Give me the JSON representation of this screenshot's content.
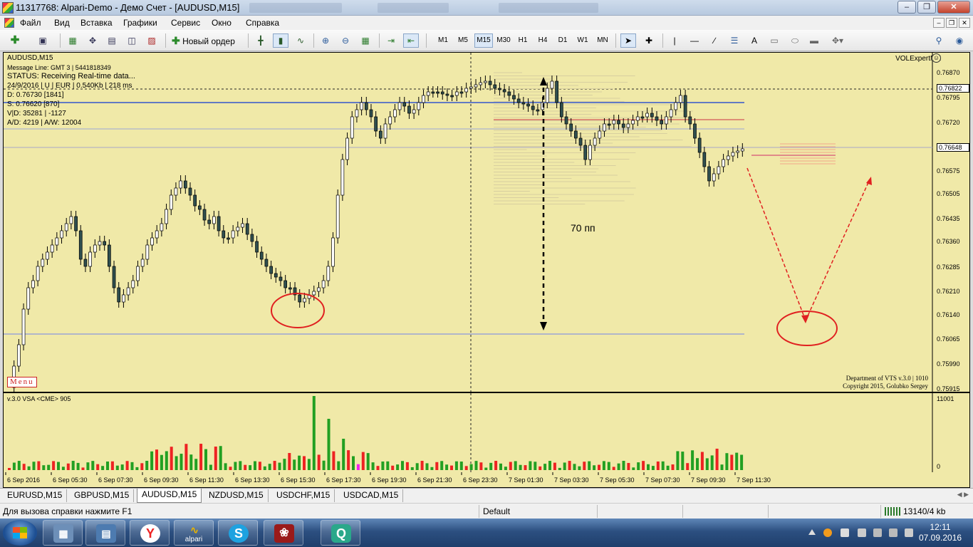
{
  "window": {
    "title": "11317768: Alpari-Demo - Демо Счет - [AUDUSD,M15]"
  },
  "menubar": {
    "items": [
      "Файл",
      "Вид",
      "Вставка",
      "Графики",
      "Сервис",
      "Окно",
      "Справка"
    ]
  },
  "toolbar": {
    "new_order_label": "Новый ордер",
    "timeframes": [
      "M1",
      "M5",
      "M15",
      "M30",
      "H1",
      "H4",
      "D1",
      "W1",
      "MN"
    ],
    "active_timeframe": "M15"
  },
  "chart": {
    "symbol_line": "AUDUSD,M15",
    "info_lines": [
      "Message Line: GMT 3 | 5441818349",
      "STATUS:  Receiving Real-time data...",
      "24/9/2016 | U | EUR | 0.540Kb | 218 ms",
      "D: 0.76730  [1841]",
      "S: 0.76620  [870]",
      "V|D: 35281 | -1127",
      "A/D: 4219 | A/W: 12004"
    ],
    "expert_name": "VOLExpertME",
    "menu_tag": "Menu",
    "copyright_lines": [
      "Department of VTS  v.3.0 | 1010",
      "Copyright 2015, Golubko Sergey"
    ],
    "annotation": "70 пп",
    "price_ticks": [
      "0.76870",
      "0.76795",
      "0.76720",
      "0.76575",
      "0.76505",
      "0.76435",
      "0.76360",
      "0.76285",
      "0.76210",
      "0.76140",
      "0.76065",
      "0.75990",
      "0.75915"
    ],
    "current_price_tag": "0.76822",
    "bid_price_tag": "0.76648",
    "time_labels": [
      "6 Sep 2016",
      "6 Sep 05:30",
      "6 Sep 07:30",
      "6 Sep 09:30",
      "6 Sep 11:30",
      "6 Sep 13:30",
      "6 Sep 15:30",
      "6 Sep 17:30",
      "6 Sep 19:30",
      "6 Sep 21:30",
      "6 Sep 23:30",
      "7 Sep 01:30",
      "7 Sep 03:30",
      "7 Sep 05:30",
      "7 Sep 07:30",
      "7 Sep 09:30",
      "7 Sep 11:30"
    ]
  },
  "vsa": {
    "label": "v.3.0 VSA <CME> 905",
    "max_label": "11001",
    "zero_label": "0"
  },
  "tabs": {
    "items": [
      "EURUSD,M15",
      "GBPUSD,M15",
      "AUDUSD,M15",
      "NZDUSD,M15",
      "USDCHF,M15",
      "USDCAD,M15"
    ],
    "active": "AUDUSD,M15"
  },
  "statusbar": {
    "help": "Для вызова справки нажмите F1",
    "profile": "Default",
    "traffic": "13140/4 kb"
  },
  "taskbar": {
    "apps": [
      "calculator",
      "explorer",
      "yandex",
      "alpari",
      "skype",
      "acrobat",
      "quik"
    ],
    "alpari_label": "alpari",
    "time": "12:11",
    "date": "07.09.2016"
  },
  "colors": {
    "chart_bg": "#f0e9a8",
    "candle_bear": "#2f4f4f",
    "candle_bull": "#ffffff",
    "level_blue": "#3355cc",
    "level_red": "#cc3344",
    "annotation_red": "#e02020",
    "volume_green": "#22a022",
    "volume_red": "#ee2222",
    "volume_magenta": "#ee22ee"
  }
}
